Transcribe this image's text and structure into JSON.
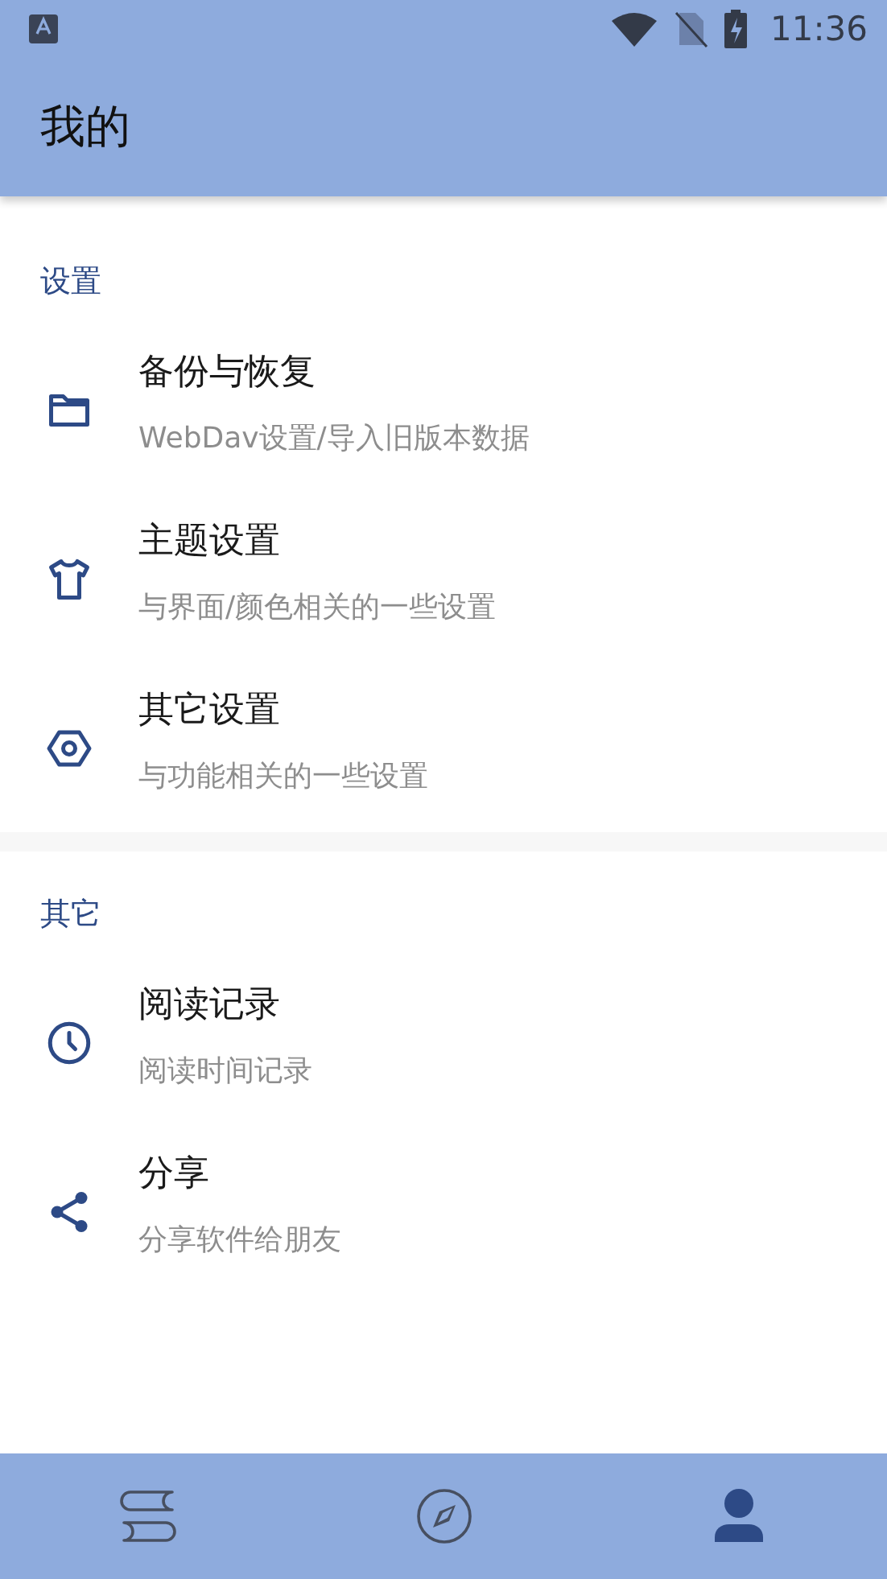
{
  "status_bar": {
    "time": "11:36"
  },
  "app_bar": {
    "title": "我的"
  },
  "sections": [
    {
      "header": "设置",
      "items": [
        {
          "kind": "folder",
          "title": "备份与恢复",
          "subtitle": "WebDav设置/导入旧版本数据"
        },
        {
          "kind": "shirt",
          "title": "主题设置",
          "subtitle": "与界面/颜色相关的一些设置"
        },
        {
          "kind": "hexagon",
          "title": "其它设置",
          "subtitle": "与功能相关的一些设置"
        }
      ]
    },
    {
      "header": "其它",
      "items": [
        {
          "kind": "clock",
          "title": "阅读记录",
          "subtitle": "阅读时间记录"
        },
        {
          "kind": "share",
          "title": "分享",
          "subtitle": "分享软件给朋友"
        }
      ]
    }
  ],
  "bottom_nav": [
    {
      "kind": "books",
      "selected": false
    },
    {
      "kind": "compass",
      "selected": false
    },
    {
      "kind": "person",
      "selected": true
    }
  ]
}
